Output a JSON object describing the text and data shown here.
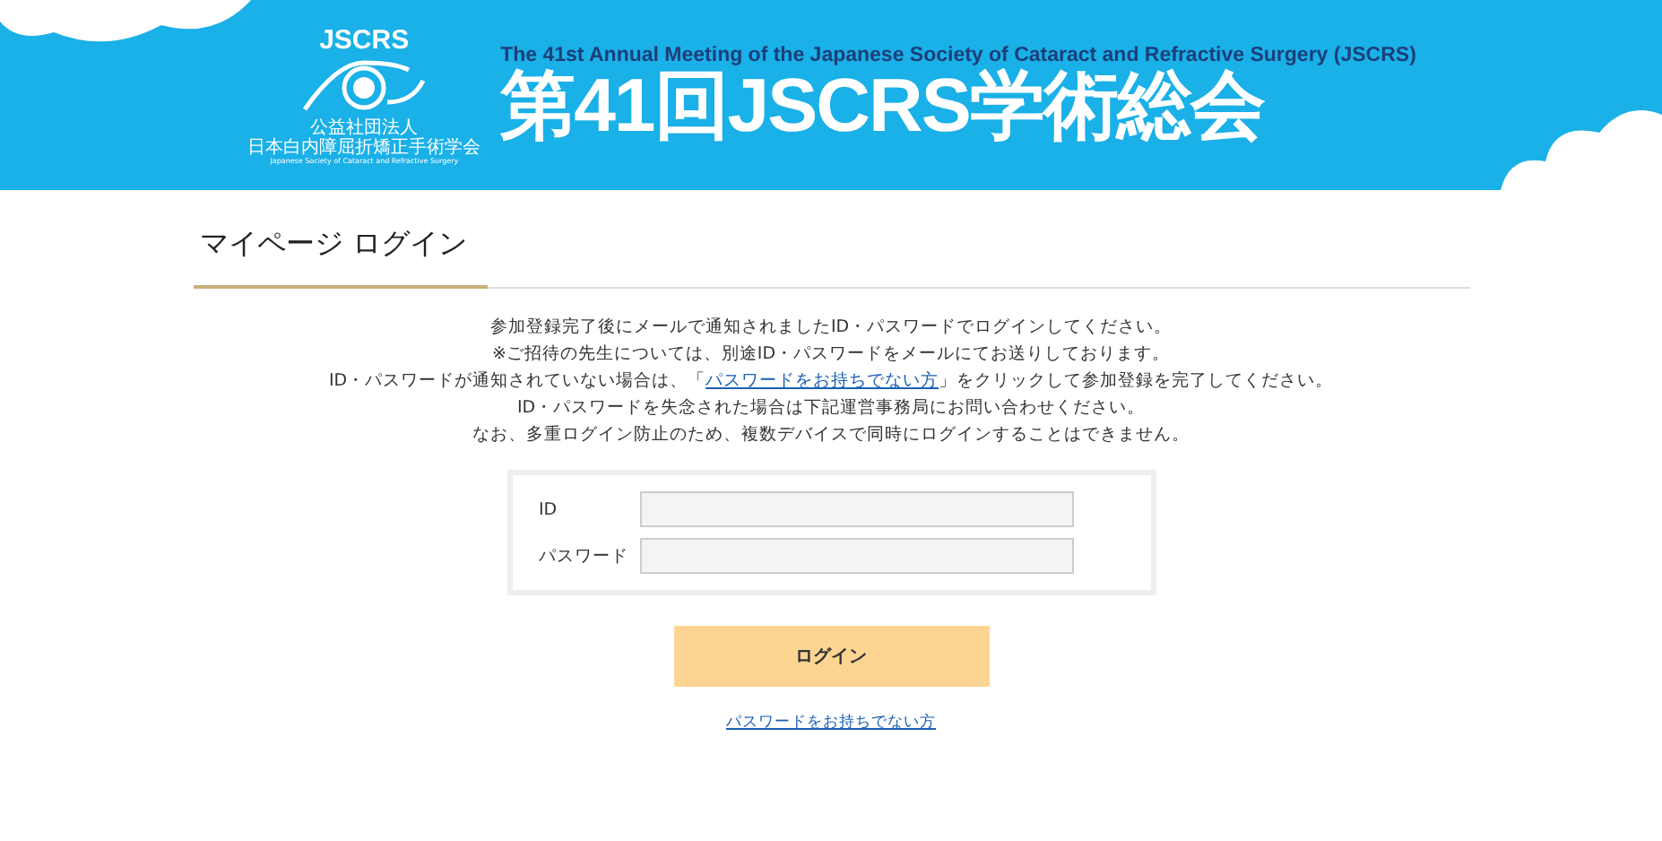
{
  "header": {
    "logo": {
      "acronym": "JSCRS",
      "org_type": "公益社団法人",
      "org_name": "日本白内障屈折矯正手術学会",
      "org_name_en": "Japanese Society of Cataract and Refractive Surgery"
    },
    "subtitle": "The 41st Annual Meeting of the Japanese Society of Cataract and Refractive Surgery (JSCRS)",
    "title": "第41回JSCRS学術総会"
  },
  "page_title": "マイページ ログイン",
  "instructions": [
    {
      "text": "参加登録完了後にメールで通知されましたID・パスワードでログインしてください。"
    },
    {
      "text": "※ご招待の先生については、別途ID・パスワードをメールにてお送りしております。"
    },
    {
      "text": "ID・パスワードが通知されていない場合は、「",
      "link": "パスワードをお持ちでない方",
      "after": "」をクリックして参加登録を完了してください。"
    },
    {
      "text": "ID・パスワードを失念された場合は下記運営事務局にお問い合わせください。"
    },
    {
      "text": "なお、多重ログイン防止のため、複数デバイスで同時にログインすることはできません。"
    }
  ],
  "form": {
    "fields": [
      {
        "label": "ID"
      },
      {
        "label": "パスワード"
      }
    ],
    "submit": "ログイン",
    "forgot_link": "パスワードをお持ちでない方"
  }
}
